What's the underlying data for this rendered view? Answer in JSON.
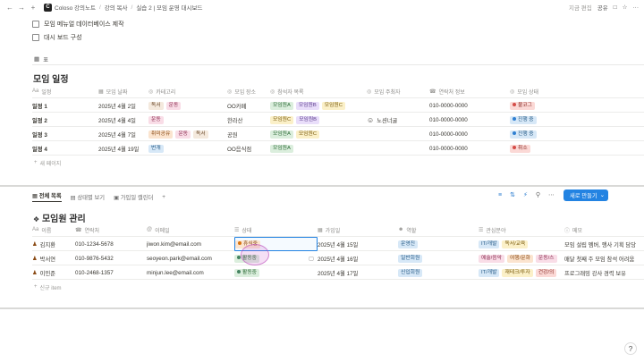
{
  "topbar": {
    "crumbs": [
      "Coloso 강의노트",
      "강의 복사",
      "실습 2 | 모임 운영 대시보드"
    ],
    "edited": "지금 편집",
    "share": "공유"
  },
  "checklist": [
    "모임 메뉴얼 데이터베이스 제작",
    "대시 보드 구성"
  ],
  "table_label": "표",
  "schedule": {
    "title": "모임 일정",
    "headers": [
      "일정",
      "모임 날짜",
      "카테고리",
      "모임 장소",
      "참석자 목록",
      "모임 주최자",
      "연락처 정보",
      "모임 상태"
    ],
    "rows": [
      {
        "name": "일정 1",
        "date": "2025년 4월 2일",
        "categories": [
          {
            "t": "독서",
            "c": "brown"
          },
          {
            "t": "운동",
            "c": "pink"
          }
        ],
        "place": "OO카페",
        "attendees": [
          {
            "t": "모임원A",
            "c": "green"
          },
          {
            "t": "모임원B",
            "c": "purple"
          },
          {
            "t": "모임원C",
            "c": "yellow"
          }
        ],
        "host": "",
        "phone": "010-0000-0000",
        "status": {
          "t": "불코그",
          "c": "red"
        }
      },
      {
        "name": "일정 2",
        "date": "2025년 4월 4일",
        "categories": [
          {
            "t": "운동",
            "c": "pink"
          }
        ],
        "place": "한라산",
        "attendees": [
          {
            "t": "모임원C",
            "c": "yellow"
          },
          {
            "t": "모임원B",
            "c": "purple"
          }
        ],
        "host": "노션너굴",
        "phone": "010-0000-0000",
        "status": {
          "t": "진행 중",
          "c": "blue"
        }
      },
      {
        "name": "일정 3",
        "date": "2025년 4월 7일",
        "categories": [
          {
            "t": "취미공유",
            "c": "orange"
          },
          {
            "t": "운동",
            "c": "pink"
          },
          {
            "t": "독서",
            "c": "brown"
          }
        ],
        "place": "공원",
        "attendees": [
          {
            "t": "모임원A",
            "c": "green"
          },
          {
            "t": "모임원C",
            "c": "yellow"
          }
        ],
        "host": "",
        "phone": "010-0000-0000",
        "status": {
          "t": "진행 중",
          "c": "blue"
        }
      },
      {
        "name": "일정 4",
        "date": "2025년 4월 19일",
        "categories": [
          {
            "t": "번개",
            "c": "blue"
          }
        ],
        "place": "OO음식점",
        "attendees": [
          {
            "t": "모임원A",
            "c": "green"
          }
        ],
        "host": "",
        "phone": "010-0000-0000",
        "status": {
          "t": "취소",
          "c": "red"
        }
      }
    ],
    "new_page": "새 페이지"
  },
  "views": {
    "tabs": [
      "전체 목록",
      "상태별 보기",
      "가입일 캘린더"
    ],
    "new_button": "새로 만들기"
  },
  "members": {
    "title": "모임원 관리",
    "headers": [
      "이름",
      "연락처",
      "이메일",
      "상태",
      "가입일",
      "역할",
      "관심분야",
      "메모"
    ],
    "rows": [
      {
        "name": "김지환",
        "phone": "010-1234-5678",
        "email": "jiwon.kim@email.com",
        "status": {
          "t": "휴식중",
          "c": "orange"
        },
        "joined": "2025년 4월 15일",
        "role": {
          "t": "운영진",
          "c": "blue"
        },
        "interests": [
          {
            "t": "IT/개발",
            "c": "blue"
          },
          {
            "t": "독서/교육",
            "c": "yellow"
          }
        ],
        "memo": "모임 설립 멤버, 행사 기획 담당"
      },
      {
        "name": "박서연",
        "phone": "010-9876-5432",
        "email": "seoyeon.park@email.com",
        "status": {
          "t": "활동중",
          "c": "green"
        },
        "joined": "2025년 4월 16일",
        "role": {
          "t": "일반회원",
          "c": "blue"
        },
        "interests": [
          {
            "t": "예술/음악",
            "c": "pink"
          },
          {
            "t": "여행/문화",
            "c": "orange"
          },
          {
            "t": "운동/스",
            "c": "pink"
          }
        ],
        "memo": "매달 첫째 주 모임 참석 어려움"
      },
      {
        "name": "이민준",
        "phone": "010-2468-1357",
        "email": "minjun.lee@email.com",
        "status": {
          "t": "활동중",
          "c": "green"
        },
        "joined": "2025년 4월 17일",
        "role": {
          "t": "신입회원",
          "c": "blue"
        },
        "interests": [
          {
            "t": "IT/개발",
            "c": "blue"
          },
          {
            "t": "재테크/투자",
            "c": "yellow"
          },
          {
            "t": "건강/의",
            "c": "red"
          }
        ],
        "memo": "프로그래밍 강사 경력 보유"
      }
    ],
    "new_item": "신규 item"
  }
}
